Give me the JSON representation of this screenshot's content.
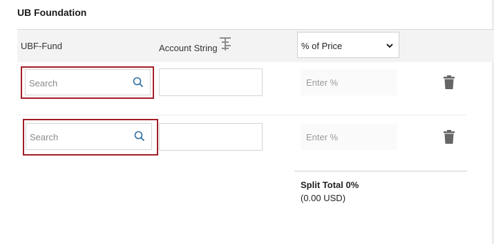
{
  "section": {
    "title": "UB Foundation"
  },
  "table": {
    "headers": {
      "fund": "UBF-Fund",
      "account": "Account String",
      "price_mode": "% of Price"
    },
    "rows": [
      {
        "fund_placeholder": "Search",
        "account_value": "",
        "percent_placeholder": "Enter %"
      },
      {
        "fund_placeholder": "Search",
        "account_value": "",
        "percent_placeholder": "Enter %"
      }
    ]
  },
  "totals": {
    "split_total": "Split Total 0%",
    "amount": "(0.00 USD)"
  },
  "icons": {
    "hierarchy": "hierarchy-icon",
    "dropdown": "chevron-down-icon",
    "search": "search-icon",
    "delete": "trash-icon"
  },
  "colors": {
    "highlight_outline": "#a31c25",
    "header_background": "#f3f3f3",
    "search_icon": "#2d6da3"
  }
}
